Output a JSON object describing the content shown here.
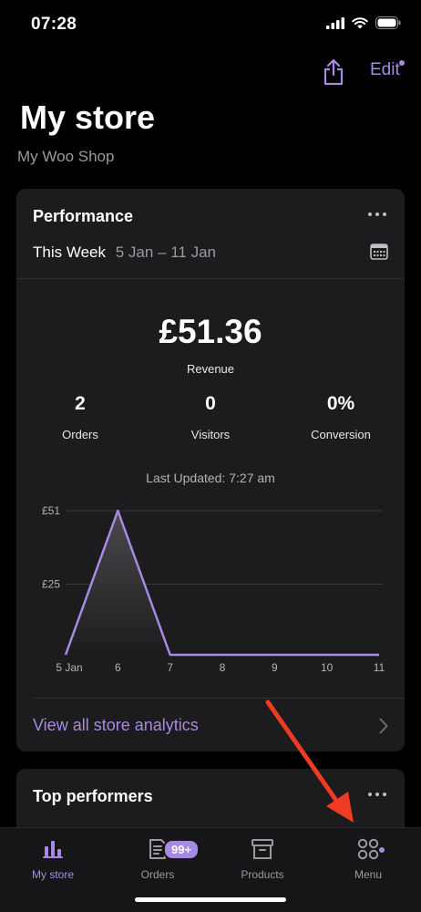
{
  "status": {
    "time": "07:28"
  },
  "header": {
    "edit_label": "Edit",
    "title": "My store",
    "store_name": "My Woo Shop"
  },
  "performance": {
    "title": "Performance",
    "range_label": "This Week",
    "range_dates": "5 Jan – 11 Jan",
    "revenue_value": "£51.36",
    "revenue_label": "Revenue",
    "stats": [
      {
        "value": "2",
        "label": "Orders"
      },
      {
        "value": "0",
        "label": "Visitors"
      },
      {
        "value": "0%",
        "label": "Conversion"
      }
    ],
    "last_updated": "Last Updated: 7:27 am",
    "view_all_label": "View all store analytics"
  },
  "chart_data": {
    "type": "area",
    "categories": [
      "5 Jan",
      "6",
      "7",
      "8",
      "9",
      "10",
      "11"
    ],
    "values": [
      0,
      51,
      0,
      0,
      0,
      0,
      0
    ],
    "y_ticks": [
      "£51",
      "£25"
    ],
    "y_tick_values": [
      51,
      25
    ],
    "ylim": [
      0,
      51
    ],
    "grid": true,
    "color": "#a68ae4"
  },
  "top_performers": {
    "title": "Top performers"
  },
  "tabs": [
    {
      "label": "My store",
      "icon": "bar-chart-icon",
      "active": true
    },
    {
      "label": "Orders",
      "icon": "orders-icon",
      "badge": "99+"
    },
    {
      "label": "Products",
      "icon": "archive-box-icon"
    },
    {
      "label": "Menu",
      "icon": "menu-grid-icon"
    }
  ],
  "colors": {
    "accent": "#a68ae4",
    "background": "#000000",
    "card": "#1c1c1e"
  }
}
